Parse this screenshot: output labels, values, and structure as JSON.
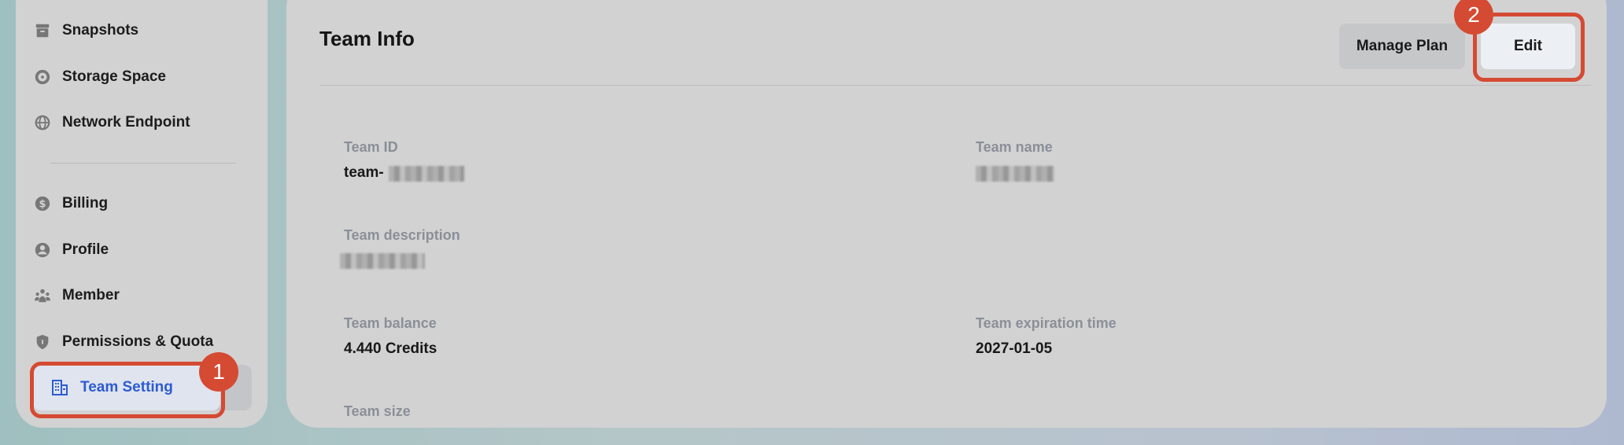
{
  "sidebar": {
    "items": [
      {
        "label": "Snapshots",
        "icon": "archive-icon"
      },
      {
        "label": "Storage Space",
        "icon": "storage-ring-icon"
      },
      {
        "label": "Network Endpoint",
        "icon": "globe-icon"
      },
      {
        "label": "Billing",
        "icon": "dollar-circle-icon"
      },
      {
        "label": "Profile",
        "icon": "user-circle-icon"
      },
      {
        "label": "Member",
        "icon": "users-icon"
      },
      {
        "label": "Permissions & Quota",
        "icon": "shield-icon"
      }
    ],
    "active_item": {
      "label": "Team Setting",
      "icon": "building-icon"
    }
  },
  "main": {
    "title": "Team Info",
    "manage_plan_label": "Manage Plan",
    "edit_label": "Edit",
    "fields": {
      "team_id_label": "Team ID",
      "team_id_value": "team-",
      "team_name_label": "Team name",
      "team_description_label": "Team description",
      "team_balance_label": "Team balance",
      "team_balance_value": "4.440 Credits",
      "team_expiration_label": "Team expiration time",
      "team_expiration_value": "2027-01-05",
      "team_size_label": "Team size"
    }
  },
  "callouts": {
    "step_1": "1",
    "step_2": "2",
    "color": "#d54a32"
  },
  "colors": {
    "accent": "#2e5bd1",
    "panel": "#d2d2d2"
  }
}
